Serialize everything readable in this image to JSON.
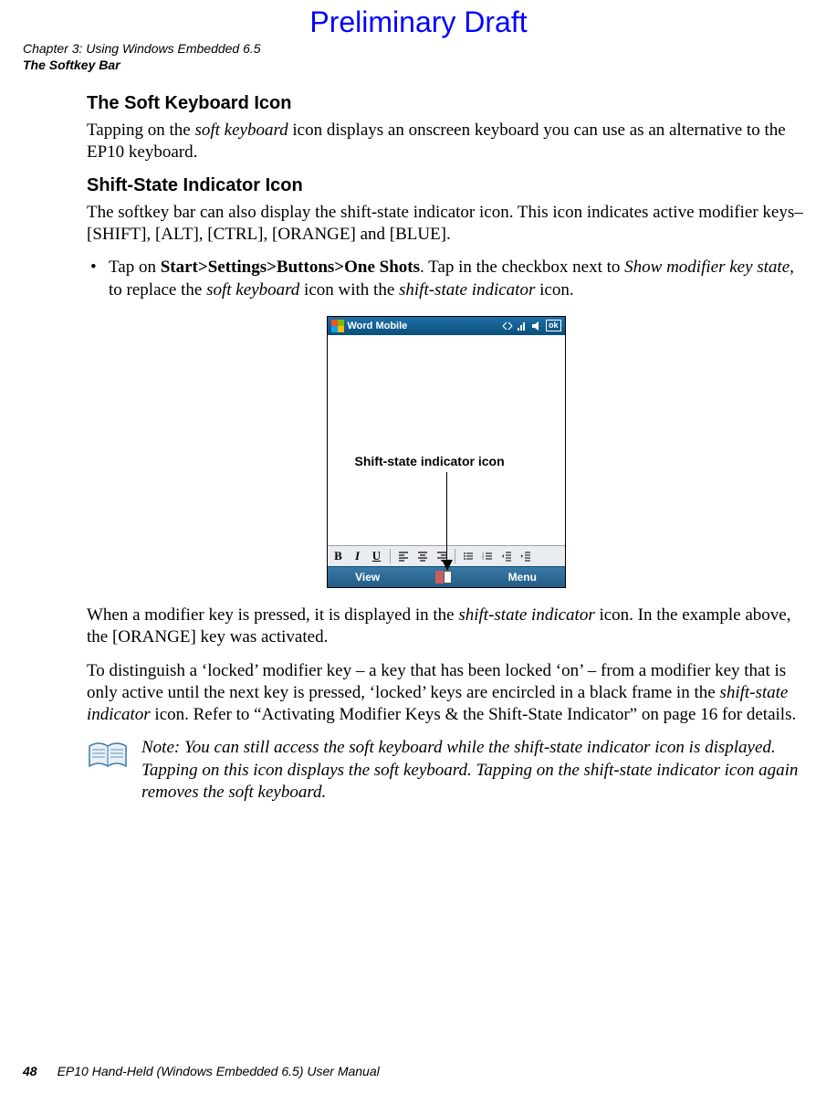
{
  "watermark": "Preliminary Draft",
  "header": {
    "chapter_line": "Chapter 3:  Using Windows Embedded 6.5",
    "section_line": "The Softkey Bar"
  },
  "section1": {
    "heading": "The Soft Keyboard Icon",
    "para1_a": "Tapping on the ",
    "para1_em1": "soft keyboard",
    "para1_b": " icon displays an onscreen keyboard you can use as an alternative to the EP10 keyboard."
  },
  "section2": {
    "heading": "Shift-State Indicator Icon",
    "para1": "The softkey bar can also display the shift-state indicator icon. This icon indicates active modifier keys–[SHIFT], [ALT], [CTRL], [ORANGE] and [BLUE].",
    "bullet_a": "Tap on ",
    "bullet_strong": "Start>Settings>Buttons>One Shots",
    "bullet_b": ". Tap in the checkbox next to ",
    "bullet_em1": "Show modifier key state,",
    "bullet_c": " to replace the ",
    "bullet_em2": "soft keyboard",
    "bullet_d": " icon with the ",
    "bullet_em3": "shift-state indicator",
    "bullet_e": " icon."
  },
  "figure": {
    "app_title": "Word Mobile",
    "ok_label": "ok",
    "callout": "Shift-state indicator icon",
    "softkeys": {
      "left": "View",
      "right": "Menu"
    }
  },
  "section3": {
    "para1_a": "When a modifier key is pressed, it is displayed in the ",
    "para1_em1": "shift-state indicator",
    "para1_b": " icon. In the example above, the [ORANGE] key was activated.",
    "para2_a": "To distinguish a ‘locked’ modifier key – a key that has been locked ‘on’ – from a modifier key that is only active until the next key is pressed, ‘locked’ keys are encircled in a black frame in the ",
    "para2_em1": "shift-state indicator",
    "para2_b": " icon. Refer to “Activating Modifier Keys & the Shift-State Indicator” on page 16 for details."
  },
  "note": {
    "prefix": "Note: ",
    "text": "You can still access the soft keyboard while the shift-state indicator icon is displayed. Tapping on this icon displays the soft keyboard. Tapping on the shift-state indicator icon again removes the soft keyboard."
  },
  "footer": {
    "page_number": "48",
    "manual_title": "EP10 Hand-Held (Windows Embedded 6.5) User Manual"
  }
}
